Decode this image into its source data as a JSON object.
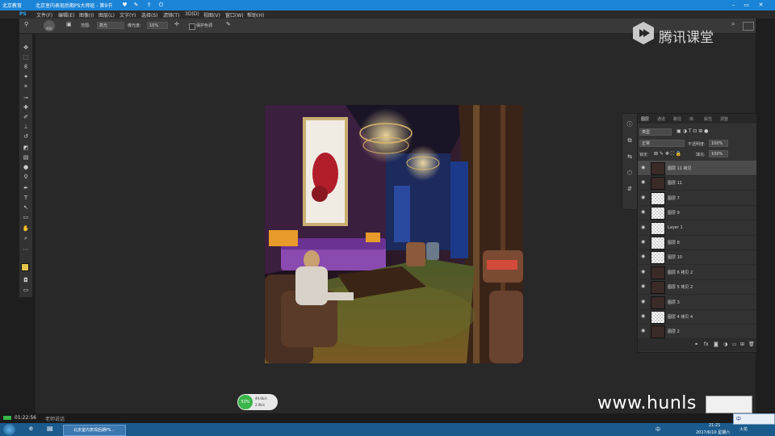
{
  "titlebar": {
    "app_name": "北京教育",
    "doc_title": "北京室内表现后期PS大师班 - 第9节",
    "colors": {
      "bg": "#1b84d6"
    }
  },
  "menu": {
    "badge": "PS",
    "items": [
      "文件(F)",
      "编辑(E)",
      "图像(I)",
      "图层(L)",
      "文字(Y)",
      "选择(S)",
      "滤镜(T)",
      "3D(D)",
      "视图(V)",
      "窗口(W)",
      "帮助(H)"
    ]
  },
  "options": {
    "brush_size": "400",
    "range_label": "范围:",
    "range_value": "高光",
    "exposure_label": "曝光度:",
    "exposure_value": "10%",
    "protect_label": "保护色调"
  },
  "layers_panel": {
    "tabs": [
      "图层",
      "通道",
      "路径",
      "库",
      "属性",
      "调整"
    ],
    "filter_value": "类型",
    "blend_mode": "正常",
    "opacity_label": "不透明度:",
    "opacity_value": "100%",
    "lock_label": "锁定:",
    "fill_label": "填充:",
    "fill_value": "100%",
    "layers": [
      {
        "name": "图层 11 拷贝",
        "thumb": "photo",
        "selected": true
      },
      {
        "name": "图层 11",
        "thumb": "photo",
        "selected": false
      },
      {
        "name": "图层 7",
        "thumb": "transparent",
        "selected": false
      },
      {
        "name": "图层 9",
        "thumb": "transparent",
        "selected": false
      },
      {
        "name": "Layer 1",
        "thumb": "transparent",
        "selected": false
      },
      {
        "name": "图层 8",
        "thumb": "transparent",
        "selected": false
      },
      {
        "name": "图层 10",
        "thumb": "transparent",
        "selected": false
      },
      {
        "name": "图层 6 拷贝 2",
        "thumb": "photo",
        "selected": false
      },
      {
        "name": "图层 5 拷贝 2",
        "thumb": "photo",
        "selected": false
      },
      {
        "name": "图层 3",
        "thumb": "photo",
        "selected": false
      },
      {
        "name": "图层 4 拷贝 4",
        "thumb": "transparent",
        "selected": false
      },
      {
        "name": "图层 2",
        "thumb": "photo",
        "selected": false
      }
    ]
  },
  "watermark": {
    "brand": "腾讯课堂",
    "url": "www.hunls"
  },
  "network_widget": {
    "percent": "53%",
    "up": "49.6k/s",
    "down": "2.9k/s"
  },
  "status": {
    "time_elapsed": "01:22:56",
    "label": "老师说话"
  },
  "taskbar": {
    "task_label": "北京室内表现后期PS...",
    "ime": "中",
    "clock_time": "21:21",
    "clock_date": "2017/6/10 星期六",
    "tray_text": "火花"
  }
}
